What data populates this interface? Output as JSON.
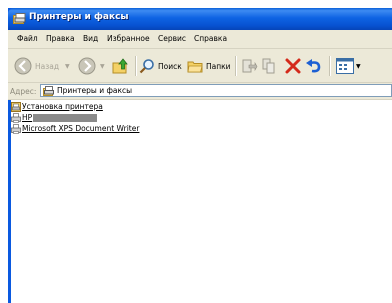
{
  "window": {
    "title": "Принтеры и факсы"
  },
  "menu": {
    "items": [
      "Файл",
      "Правка",
      "Вид",
      "Избранное",
      "Сервис",
      "Справка"
    ]
  },
  "toolbar": {
    "back_label": "Назад",
    "search_label": "Поиск",
    "folders_label": "Папки"
  },
  "address": {
    "label": "Адрес:",
    "value": "Принтеры и факсы"
  },
  "items": [
    {
      "label": "Установка принтера",
      "icon": "add-printer-icon"
    },
    {
      "label": "HP",
      "icon": "printer-icon"
    },
    {
      "label": "Microsoft XPS Document Writer",
      "icon": "printer-icon"
    }
  ],
  "colors": {
    "titlebar": "#0a5fd8",
    "chrome": "#ece9d8",
    "delete_red": "#d42a1b"
  }
}
